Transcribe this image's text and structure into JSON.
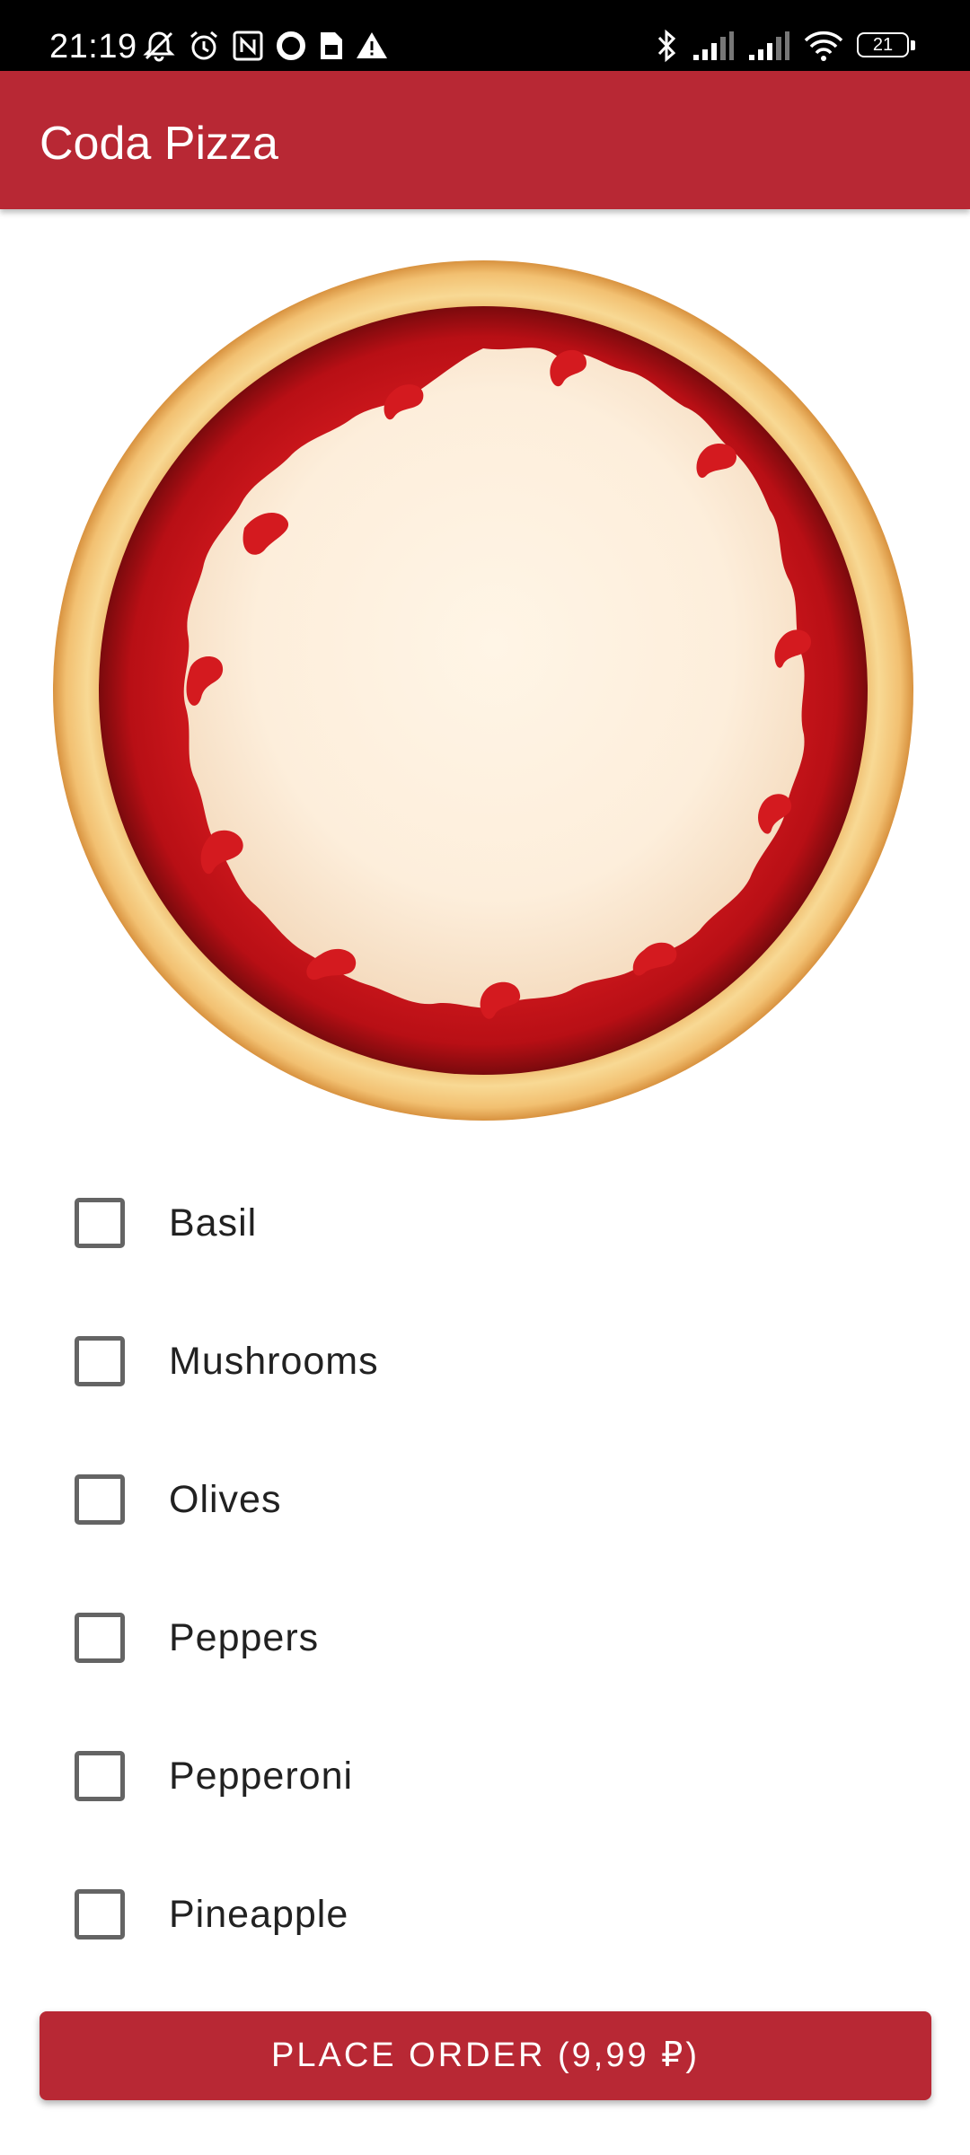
{
  "status_bar": {
    "time": "21:19",
    "battery_level": "21",
    "left_icons": [
      "muted-bell-icon",
      "alarm-icon",
      "nfc-icon",
      "circle-icon",
      "sim-card-icon",
      "warning-icon"
    ],
    "right_icons": [
      "bluetooth-icon",
      "signal-icon",
      "signal-icon",
      "wifi-icon",
      "battery-icon"
    ]
  },
  "app_bar": {
    "title": "Coda Pizza",
    "color": "#b82834"
  },
  "pizza": {
    "image": "pizza-base-with-sauce",
    "colors": {
      "crust": "#f4c774",
      "sauce": "#c8161c",
      "cheese": "#fdf0dc"
    }
  },
  "toppings": [
    {
      "label": "Basil",
      "checked": false
    },
    {
      "label": "Mushrooms",
      "checked": false
    },
    {
      "label": "Olives",
      "checked": false
    },
    {
      "label": "Peppers",
      "checked": false
    },
    {
      "label": "Pepperoni",
      "checked": false
    },
    {
      "label": "Pineapple",
      "checked": false
    }
  ],
  "order_button": {
    "label": "PLACE ORDER (9,99 ₽)"
  }
}
